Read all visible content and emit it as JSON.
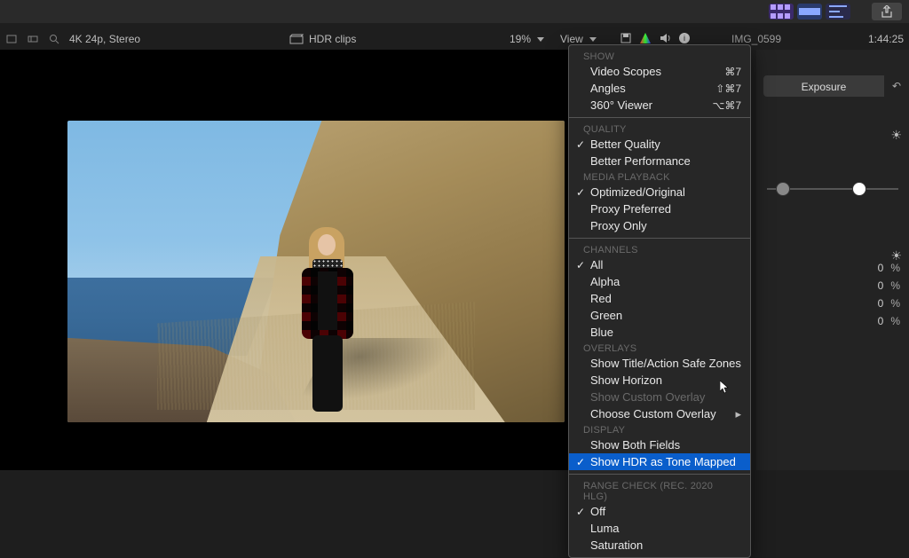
{
  "topbar": {
    "share_tooltip": "Share"
  },
  "info": {
    "format": "4K 24p, Stereo",
    "hdr_label": "HDR clips",
    "zoom": "19%",
    "view_label": "View",
    "clip_name": "IMG_0599",
    "timecode": "1:44:25"
  },
  "menu": {
    "sections": {
      "show": "SHOW",
      "quality": "QUALITY",
      "media": "MEDIA PLAYBACK",
      "channels": "CHANNELS",
      "overlays": "OVERLAYS",
      "display": "DISPLAY",
      "range": "RANGE CHECK (Rec. 2020 HLG)"
    },
    "items": {
      "video_scopes": "Video Scopes",
      "angles": "Angles",
      "viewer360": "360° Viewer",
      "better_quality": "Better Quality",
      "better_perf": "Better Performance",
      "opt_orig": "Optimized/Original",
      "proxy_pref": "Proxy Preferred",
      "proxy_only": "Proxy Only",
      "all": "All",
      "alpha": "Alpha",
      "red": "Red",
      "green": "Green",
      "blue": "Blue",
      "safe_zones": "Show Title/Action Safe Zones",
      "horizon": "Show Horizon",
      "custom_overlay_show": "Show Custom Overlay",
      "custom_overlay_choose": "Choose Custom Overlay",
      "both_fields": "Show Both Fields",
      "hdr_tm": "Show HDR as Tone Mapped",
      "off": "Off",
      "luma": "Luma",
      "saturation": "Saturation"
    },
    "shortcuts": {
      "video_scopes": "⌘7",
      "angles": "⇧⌘7",
      "viewer360": "⌥⌘7"
    }
  },
  "inspector": {
    "tab_exposure": "Exposure",
    "sun_small": "☀︎",
    "sun_big": "☀︎",
    "params": [
      {
        "value": "0",
        "unit": "%"
      },
      {
        "value": "0",
        "unit": "%"
      },
      {
        "value": "0",
        "unit": "%"
      },
      {
        "value": "0",
        "unit": "%"
      }
    ]
  }
}
